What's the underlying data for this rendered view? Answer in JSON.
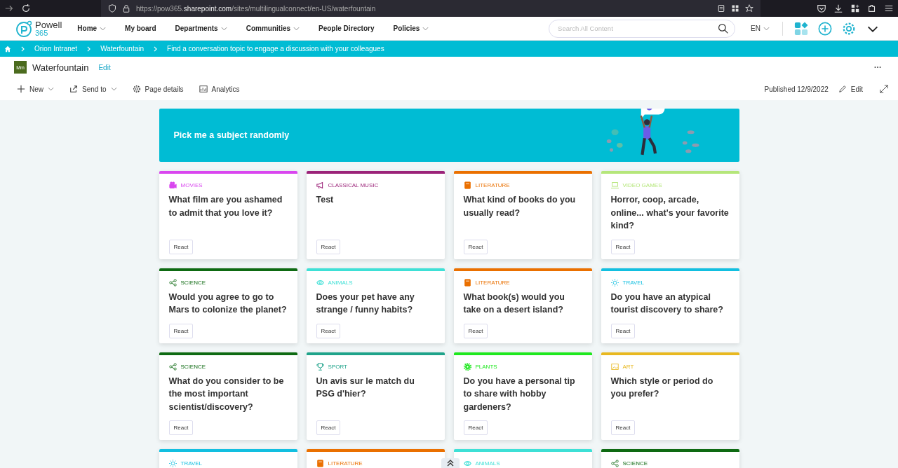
{
  "browser": {
    "url_prefix": "https://pow365.",
    "url_domain": "sharepoint.com",
    "url_path": "/sites/multilingualconnect/en-US/waterfountain"
  },
  "logo": {
    "name": "Powell",
    "sub": "365"
  },
  "nav": [
    {
      "label": "Home",
      "dropdown": true
    },
    {
      "label": "My board",
      "dropdown": false
    },
    {
      "label": "Departments",
      "dropdown": true
    },
    {
      "label": "Communities",
      "dropdown": true
    },
    {
      "label": "People Directory",
      "dropdown": false
    },
    {
      "label": "Policies",
      "dropdown": true
    }
  ],
  "search": {
    "placeholder": "Search All Content"
  },
  "language": "EN",
  "breadcrumb": [
    "Orion Intranet",
    "Waterfountain",
    "Find a conversation topic to engage a discussion with your colleagues"
  ],
  "site": {
    "initials": "Mm",
    "title": "Waterfountain",
    "edit": "Edit"
  },
  "commands": [
    {
      "label": "New",
      "kind": "plus",
      "dropdown": true
    },
    {
      "label": "Send to",
      "kind": "share",
      "dropdown": true
    },
    {
      "label": "Page details",
      "kind": "gear",
      "dropdown": false
    },
    {
      "label": "Analytics",
      "kind": "chart",
      "dropdown": false
    }
  ],
  "published": "Published 12/9/2022",
  "edit": "Edit",
  "banner": {
    "title": "Pick me a subject randomly"
  },
  "cards": [
    {
      "category": "MOVIES",
      "kind": "camera",
      "color": "#d946ef",
      "question": "What film are you ashamed to admit that you love it?",
      "button": "React"
    },
    {
      "category": "CLASSICAL MUSIC",
      "kind": "megaphone",
      "color": "#9b2379",
      "question": "Test",
      "button": "React"
    },
    {
      "category": "LITERATURE",
      "kind": "book",
      "color": "#ea7000",
      "question": "What kind of books do you usually read?",
      "button": "React"
    },
    {
      "category": "VIDEO GAMES",
      "kind": "laptop",
      "color": "#b5e67a",
      "question": "Horror, coop, arcade, online... what's your favorite kind?",
      "button": "React"
    },
    {
      "category": "SCIENCE",
      "kind": "share",
      "color": "#0e6a12",
      "question": "Would you agree to go to Mars to colonize the planet?",
      "button": "React"
    },
    {
      "category": "ANIMALS",
      "kind": "eye",
      "color": "#3ee0d6",
      "question": "Does your pet have any strange / funny habits?",
      "button": "React"
    },
    {
      "category": "LITERATURE",
      "kind": "book",
      "color": "#ea7000",
      "question": "What book(s) would you take on a desert island?",
      "button": "React"
    },
    {
      "category": "TRAVEL",
      "kind": "sun",
      "color": "#12bfe0",
      "question": "Do you have an atypical tourist discovery to share?",
      "button": "React"
    },
    {
      "category": "SCIENCE",
      "kind": "share",
      "color": "#0e6a12",
      "question": "What do you consider to be the most important scientist/discovery?",
      "button": "React"
    },
    {
      "category": "SPORT",
      "kind": "trophy",
      "color": "#1fa38a",
      "question": "Un avis sur le match du PSG d'hier?",
      "button": "React"
    },
    {
      "category": "PLANTS",
      "kind": "gear",
      "color": "#1ee81e",
      "question": "Do you have a personal tip to share with hobby gardeners?",
      "button": "React"
    },
    {
      "category": "ART",
      "kind": "image",
      "color": "#e8b820",
      "question": "Which style or period do you prefer?",
      "button": "React"
    },
    {
      "category": "TRAVEL",
      "kind": "sun",
      "color": "#12bfe0"
    },
    {
      "category": "LITERATURE",
      "kind": "book",
      "color": "#ea7000"
    },
    {
      "category": "ANIMALS",
      "kind": "eye",
      "color": "#3ee0d6"
    },
    {
      "category": "SCIENCE",
      "kind": "share",
      "color": "#0e6a12"
    }
  ]
}
